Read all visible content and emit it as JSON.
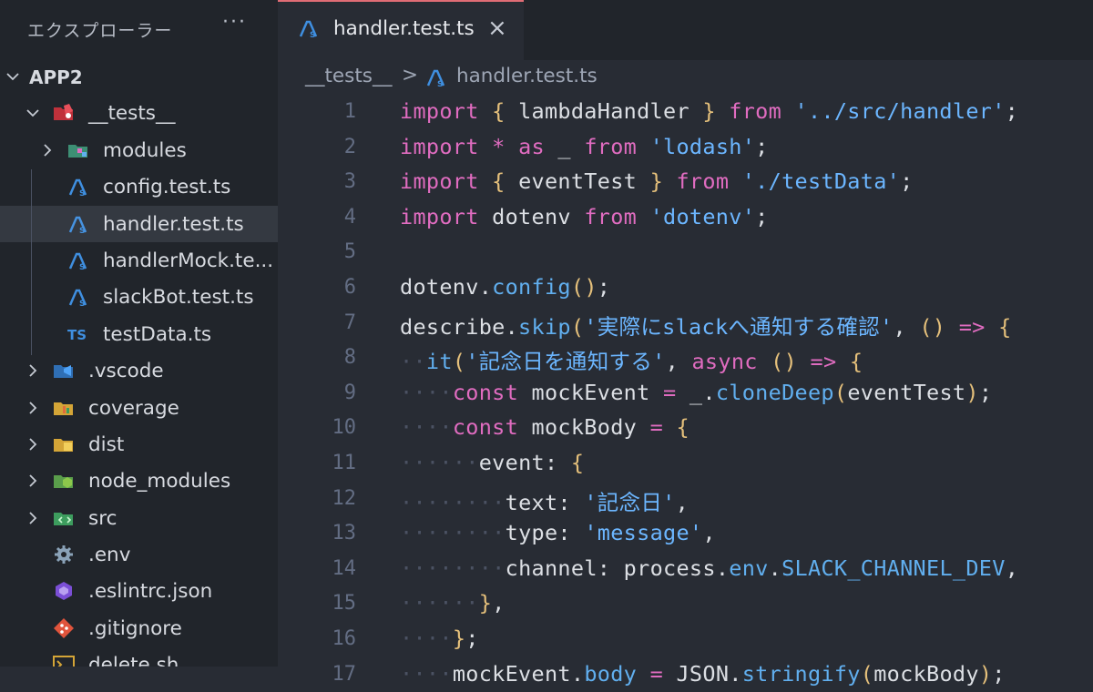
{
  "explorer": {
    "title": "エクスプローラー",
    "more": "···",
    "root": "APP2",
    "items": [
      {
        "label": "__tests__",
        "type": "folder-open",
        "icon": "test-folder-icon"
      },
      {
        "label": "modules",
        "type": "folder",
        "icon": "modules-folder-icon"
      },
      {
        "label": "config.test.ts",
        "type": "file",
        "icon": "ts-test-icon"
      },
      {
        "label": "handler.test.ts",
        "type": "file",
        "icon": "ts-test-icon",
        "selected": true
      },
      {
        "label": "handlerMock.te...",
        "type": "file",
        "icon": "ts-test-icon"
      },
      {
        "label": "slackBot.test.ts",
        "type": "file",
        "icon": "ts-test-icon"
      },
      {
        "label": "testData.ts",
        "type": "file",
        "icon": "ts-file-icon"
      },
      {
        "label": ".vscode",
        "type": "folder",
        "icon": "vscode-folder-icon"
      },
      {
        "label": "coverage",
        "type": "folder",
        "icon": "coverage-folder-icon"
      },
      {
        "label": "dist",
        "type": "folder",
        "icon": "dist-folder-icon"
      },
      {
        "label": "node_modules",
        "type": "folder",
        "icon": "node-folder-icon"
      },
      {
        "label": "src",
        "type": "folder",
        "icon": "src-folder-icon"
      },
      {
        "label": ".env",
        "type": "file",
        "icon": "gear-icon"
      },
      {
        "label": ".eslintrc.json",
        "type": "file",
        "icon": "eslint-icon"
      },
      {
        "label": ".gitignore",
        "type": "file",
        "icon": "git-icon"
      },
      {
        "label": "delete.sh",
        "type": "file",
        "icon": "terminal-icon"
      }
    ]
  },
  "tab": {
    "label": "handler.test.ts",
    "close": "×"
  },
  "breadcrumb": {
    "folder": "__tests__",
    "sep": ">",
    "file": "handler.test.ts"
  },
  "code": {
    "line_numbers": [
      "1",
      "2",
      "3",
      "4",
      "5",
      "6",
      "7",
      "8",
      "9",
      "10",
      "11",
      "12",
      "13",
      "14",
      "15",
      "16",
      "17"
    ],
    "lines": [
      "import { lambdaHandler } from '../src/handler';",
      "import * as _ from 'lodash';",
      "import { eventTest } from './testData';",
      "import dotenv from 'dotenv';",
      "",
      "dotenv.config();",
      "describe.skip('実際にslackへ通知する確認', () => {",
      "  it('記念日を通知する', async () => {",
      "    const mockEvent = _.cloneDeep(eventTest);",
      "    const mockBody = {",
      "      event: {",
      "        text: '記念日',",
      "        type: 'message',",
      "        channel: process.env.SLACK_CHANNEL_DEV,",
      "      },",
      "    };",
      "    mockEvent.body = JSON.stringify(mockBody);"
    ]
  },
  "colors": {
    "keyword": "#e06cc0",
    "string": "#6cb6ff",
    "function": "#61afef",
    "bracket": "#e5c07b",
    "tab_accent": "#e06c75"
  }
}
